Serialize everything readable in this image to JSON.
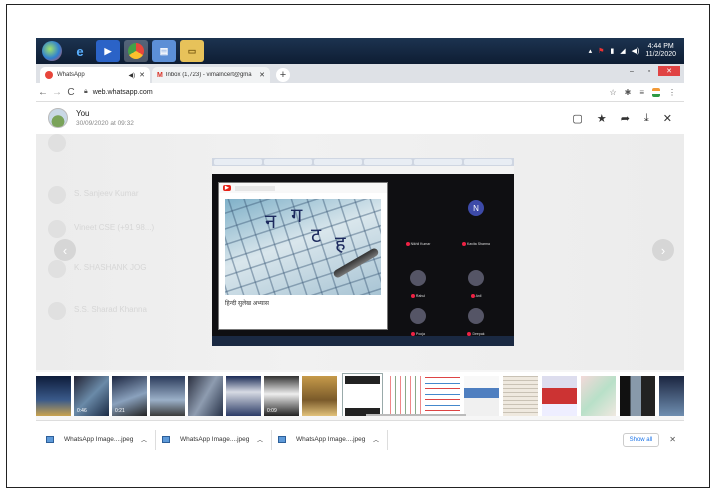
{
  "taskbar": {
    "clock_time": "4:44 PM",
    "clock_date": "11/2/2020",
    "apps": [
      "ie-icon",
      "media-player-icon",
      "chrome-icon",
      "notepad-icon",
      "explorer-icon"
    ]
  },
  "browser": {
    "tabs": [
      {
        "label": "WhatsApp",
        "favicon_color": "#e8463b"
      },
      {
        "label": "Inbox (1,723) - vimalncert@gma",
        "favicon_color": "#d93025"
      }
    ],
    "new_tab": "+",
    "url": "web.whatsapp.com"
  },
  "viewer": {
    "sender": "You",
    "timestamp": "30/09/2020 at 09:32",
    "actions": [
      "message-icon",
      "star-icon",
      "forward-icon",
      "download-icon",
      "close-icon"
    ],
    "media_caption": "हिन्दी सुलेख अभ्यास",
    "video_glyphs": [
      "न",
      "ग",
      "ट",
      "ह"
    ],
    "participants": [
      "N",
      "Nikhil Kumar",
      "Kavita Sharma",
      "Rahul",
      "Anil",
      "Pooja",
      "Deepak"
    ],
    "background_chats": [
      "S. Sanjeev Kumar",
      "Vineet CSE (+91 98...)",
      "K. SHASHANK JOG",
      "S.S. Sharad Khanna"
    ]
  },
  "thumbnails": {
    "captions": [
      "0:46",
      "0:21",
      "0:09"
    ]
  },
  "downloads": {
    "items": [
      {
        "name": "WhatsApp Image....jpeg"
      },
      {
        "name": "WhatsApp Image....jpeg"
      },
      {
        "name": "WhatsApp Image....jpeg"
      }
    ],
    "show_all": "Show all"
  },
  "colors": {
    "taskbar": "#1c3350",
    "tabstrip": "#dee1e6",
    "show_all": "#1a73e8"
  }
}
